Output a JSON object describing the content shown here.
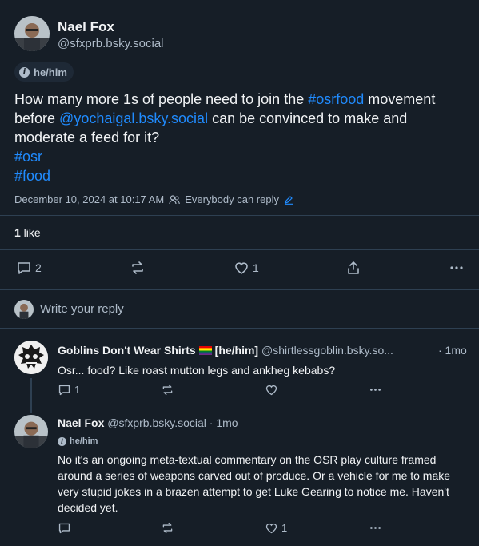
{
  "post": {
    "author_name": "Nael Fox",
    "author_handle": "@sfxprb.bsky.social",
    "pronouns": "he/him",
    "text_before": "How many more 1s of people need to join the ",
    "hashtag_inline": "#osrfood",
    "text_mid": " movement before ",
    "mention": "@yochaigal.bsky.social",
    "text_after": " can be convinced to make and moderate a feed for it?",
    "hashtag_1": "#osr",
    "hashtag_2": "#food",
    "timestamp": "December 10, 2024 at 10:17 AM",
    "reply_setting": "Everybody can reply",
    "like_count": "1",
    "like_label": " like",
    "reply_count": "2",
    "likes_action_count": "1"
  },
  "reply_box": {
    "placeholder": "Write your reply"
  },
  "replies": [
    {
      "author_name": "Goblins Don't Wear Shirts",
      "author_extra": "[he/him]",
      "author_handle": "@shirtlessgoblin.bsky.so...",
      "time": "· 1mo",
      "text": "Osr... food? Like roast mutton legs and ankheg kebabs?",
      "reply_count": "1",
      "like_count": ""
    },
    {
      "author_name": "Nael Fox",
      "author_handle": "@sfxprb.bsky.social",
      "time": "· 1mo",
      "pronouns": "he/him",
      "text": "No it's an ongoing meta-textual commentary on the OSR play culture framed around a series of weapons carved out of produce. Or a vehicle for me to make very stupid jokes in a brazen attempt to get Luke Gearing to notice me. Haven't decided yet.",
      "reply_count": "",
      "like_count": "1"
    }
  ],
  "colors": {
    "background": "#161e27",
    "link": "#208bfe",
    "muted": "#aebbc9",
    "border": "#2e4052"
  }
}
